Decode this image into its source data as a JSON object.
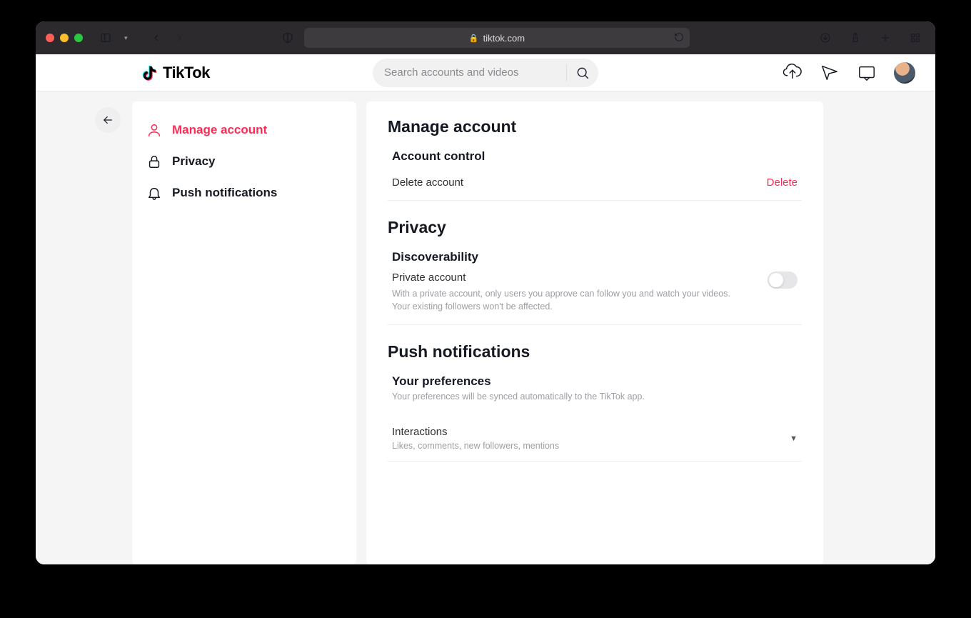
{
  "browser": {
    "url_host": "tiktok.com"
  },
  "header": {
    "brand": "TikTok",
    "search_placeholder": "Search accounts and videos"
  },
  "sidebar": {
    "items": [
      {
        "label": "Manage account",
        "icon": "person-icon",
        "active": true
      },
      {
        "label": "Privacy",
        "icon": "lock-icon",
        "active": false
      },
      {
        "label": "Push notifications",
        "icon": "bell-icon",
        "active": false
      }
    ]
  },
  "sections": {
    "manage_account": {
      "title": "Manage account",
      "account_control_label": "Account control",
      "delete_account_label": "Delete account",
      "delete_action": "Delete"
    },
    "privacy": {
      "title": "Privacy",
      "discoverability_label": "Discoverability",
      "private_account_label": "Private account",
      "private_account_desc": "With a private account, only users you approve can follow you and watch your videos. Your existing followers won't be affected.",
      "private_account_on": false
    },
    "push": {
      "title": "Push notifications",
      "preferences_label": "Your preferences",
      "preferences_desc": "Your preferences will be synced automatically to the TikTok app.",
      "interactions_label": "Interactions",
      "interactions_desc": "Likes, comments, new followers, mentions"
    }
  }
}
